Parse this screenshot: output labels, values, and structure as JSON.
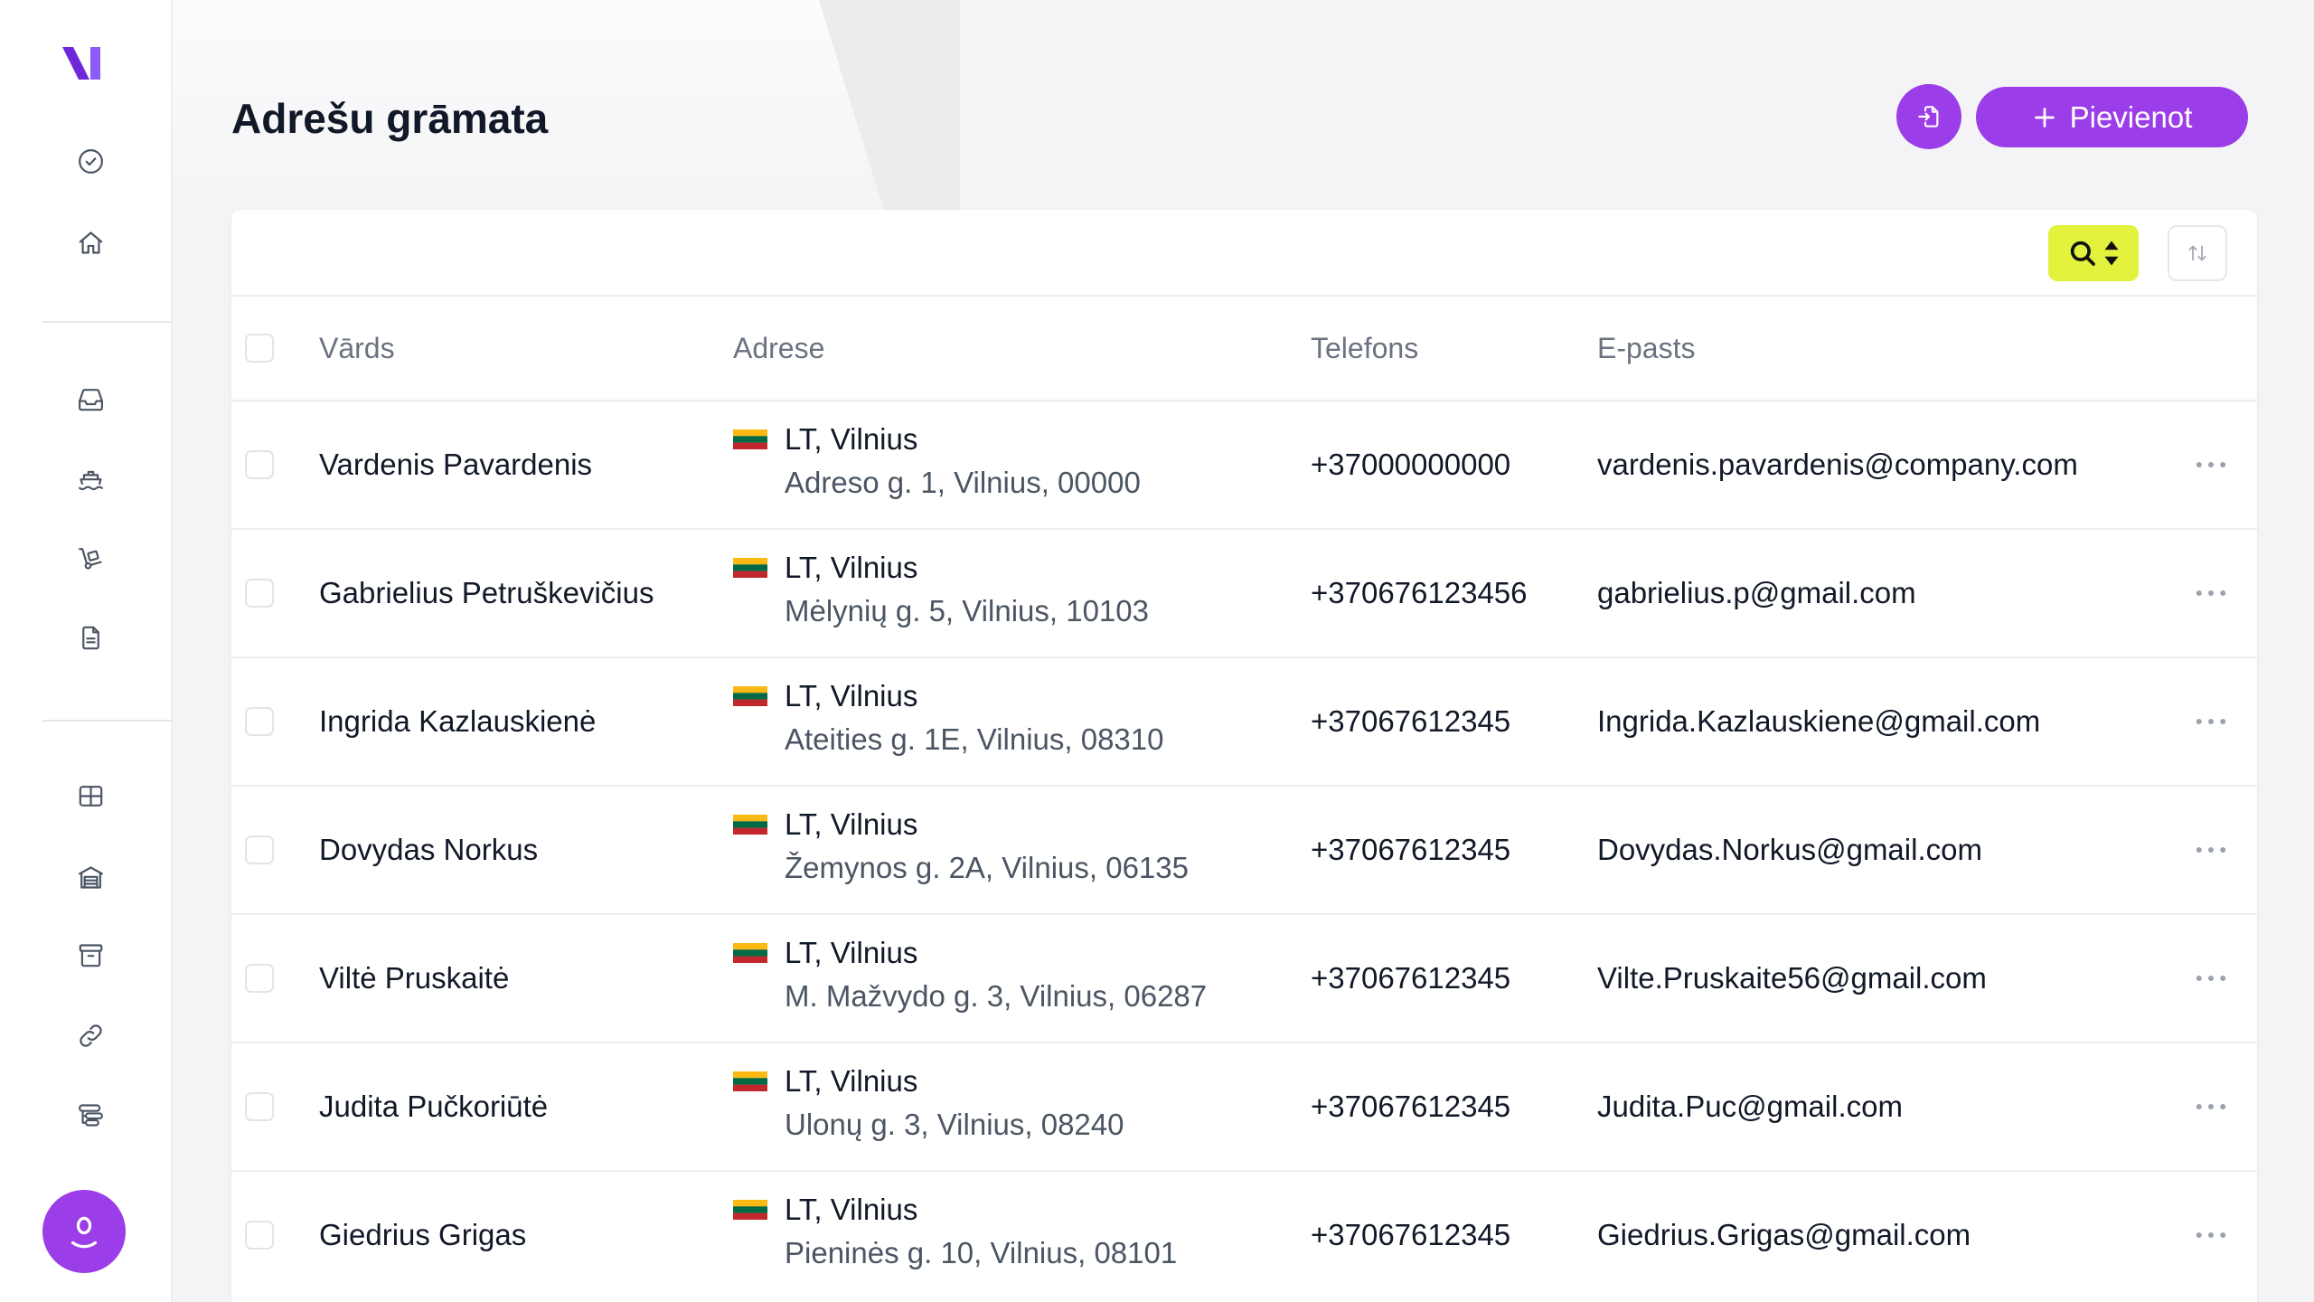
{
  "colors": {
    "accent": "#9b3de8",
    "search_button": "#e3f23c",
    "sidebar_icon": "#4b5563",
    "text_primary": "#111827",
    "text_muted": "#6b7280",
    "logo_primary": "#6d28d9",
    "logo_secondary": "#8b5cf6",
    "flag_yellow": "#fdb913",
    "flag_green": "#006a44",
    "flag_red": "#c1272d"
  },
  "sidebar": {
    "logo_icon": "app-logo-icon",
    "top_items": [
      {
        "icon": "check-circle-icon"
      },
      {
        "icon": "home-icon"
      }
    ],
    "middle_items": [
      {
        "icon": "inbox-icon"
      },
      {
        "icon": "ship-icon"
      },
      {
        "icon": "hand-truck-icon"
      },
      {
        "icon": "document-icon"
      }
    ],
    "bottom_items": [
      {
        "icon": "table-grid-icon"
      },
      {
        "icon": "warehouse-icon"
      },
      {
        "icon": "archive-icon"
      },
      {
        "icon": "link-icon"
      },
      {
        "icon": "route-stack-icon"
      }
    ],
    "user_avatar_icon": "user-icon"
  },
  "header": {
    "title": "Adrešu grāmata",
    "import_button_icon": "file-import-icon",
    "add_button": {
      "icon": "plus-icon",
      "label": "Pievienot"
    }
  },
  "toolbar": {
    "search_icon": "search-icon",
    "search_toggle_icon": "caret-up-down-icon",
    "sort_icon": "sort-arrows-icon"
  },
  "table": {
    "columns": [
      "Vārds",
      "Adrese",
      "Telefons",
      "E-pasts"
    ],
    "row_actions_icon": "more-horizontal-icon",
    "rows": [
      {
        "name": "Vardenis Pavardenis",
        "flag": "lithuania-flag-icon",
        "location": "LT, Vilnius",
        "street": "Adreso g. 1, Vilnius, 00000",
        "phone": "+37000000000",
        "email": "vardenis.pavardenis@company.com"
      },
      {
        "name": "Gabrielius Petruškevičius",
        "flag": "lithuania-flag-icon",
        "location": "LT, Vilnius",
        "street": "Mėlynių g. 5, Vilnius, 10103",
        "phone": "+370676123456",
        "email": "gabrielius.p@gmail.com"
      },
      {
        "name": "Ingrida Kazlauskienė",
        "flag": "lithuania-flag-icon",
        "location": "LT, Vilnius",
        "street": "Ateities g. 1E, Vilnius, 08310",
        "phone": "+37067612345",
        "email": "Ingrida.Kazlauskiene@gmail.com"
      },
      {
        "name": "Dovydas Norkus",
        "flag": "lithuania-flag-icon",
        "location": "LT, Vilnius",
        "street": "Žemynos g. 2A, Vilnius, 06135",
        "phone": "+37067612345",
        "email": "Dovydas.Norkus@gmail.com"
      },
      {
        "name": "Viltė Pruskaitė",
        "flag": "lithuania-flag-icon",
        "location": "LT, Vilnius",
        "street": "M. Mažvydo g. 3, Vilnius, 06287",
        "phone": "+37067612345",
        "email": "Vilte.Pruskaite56@gmail.com"
      },
      {
        "name": "Judita Pučkoriūtė",
        "flag": "lithuania-flag-icon",
        "location": "LT, Vilnius",
        "street": "Ulonų g. 3, Vilnius, 08240",
        "phone": "+37067612345",
        "email": "Judita.Puc@gmail.com"
      },
      {
        "name": "Giedrius Grigas",
        "flag": "lithuania-flag-icon",
        "location": "LT, Vilnius",
        "street": "Pieninės g. 10, Vilnius, 08101",
        "phone": "+37067612345",
        "email": "Giedrius.Grigas@gmail.com"
      }
    ]
  }
}
